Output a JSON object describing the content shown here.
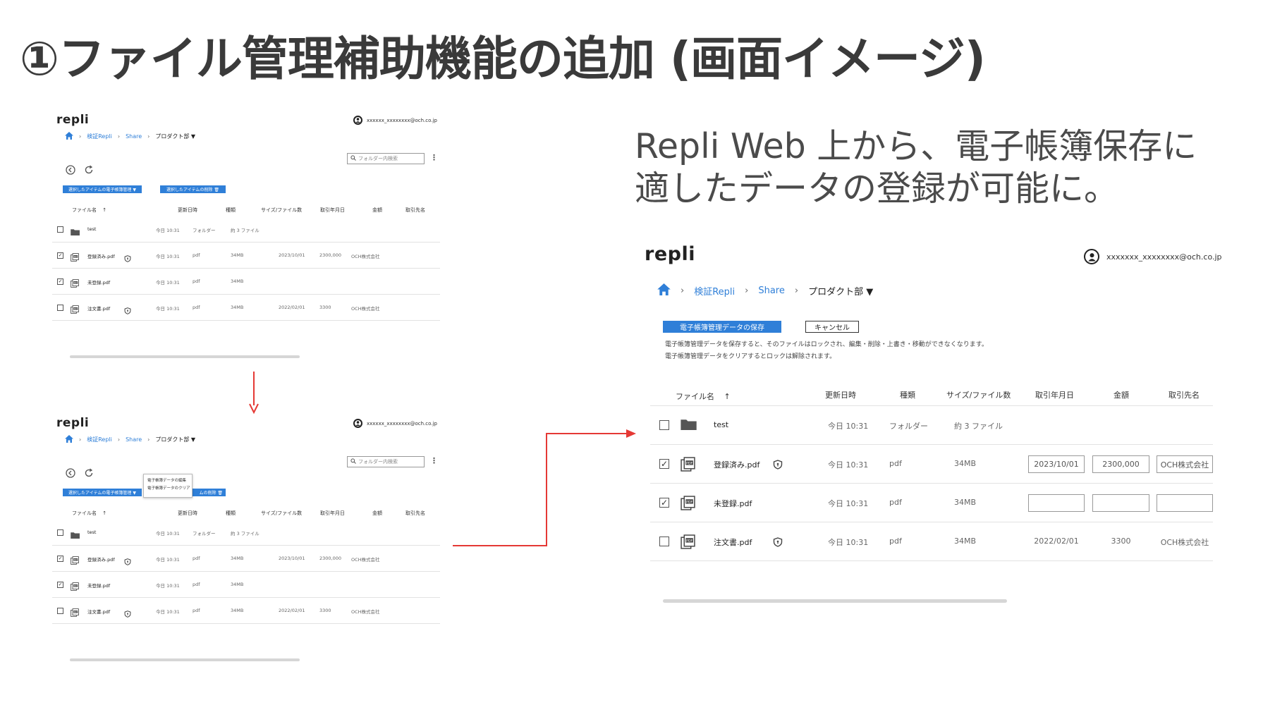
{
  "slide": {
    "title": "①ファイル管理補助機能の追加 (画面イメージ)",
    "description_line1": "Repli Web 上から、電子帳簿保存に",
    "description_line2": "適したデータの登録が可能に。"
  },
  "app": {
    "logo": "repli",
    "account_email": "xxxxxxx_xxxxxxxx@och.co.jp",
    "account_email_small": "xxxxxx_xxxxxxxx@och.co.jp",
    "breadcrumb": [
      "検証Repli",
      "Share",
      "プロダクト部 ▼"
    ],
    "search_placeholder": "フォルダー内検索",
    "btn_edoc_manage": "選択したアイテムの電子帳簿管理 ▼",
    "btn_delete": "選択したアイテムの削除 🗑",
    "btn_delete_partial": "ムの削除 🗑",
    "popup_items": [
      "電子帳簿データの編集",
      "電子帳簿データのクリア"
    ],
    "btn_save_edoc": "電子帳簿管理データの保存",
    "btn_cancel": "キャンセル",
    "note_line1": "電子帳簿管理データを保存すると、そのファイルはロックされ、編集・削除・上書き・移動ができなくなります。",
    "note_line2": "電子帳簿管理データをクリアするとロックは解除されます。",
    "columns": {
      "name": "ファイル名",
      "sort": "↑",
      "updated": "更新日時",
      "type": "種類",
      "size": "サイズ/ファイル数",
      "date": "取引年月日",
      "amount": "金額",
      "partner": "取引先名"
    },
    "rows": [
      {
        "name": "test",
        "updated": "今日 10:31",
        "type": "フォルダー",
        "size": "約 3 ファイル",
        "date": "",
        "amount": "",
        "partner": "",
        "checked": false,
        "kind": "folder",
        "locked": false
      },
      {
        "name": "登録済み.pdf",
        "updated": "今日 10:31",
        "type": "pdf",
        "size": "34MB",
        "date": "2023/10/01",
        "amount": "2300,000",
        "partner": "OCH株式会社",
        "checked": true,
        "kind": "pdf",
        "locked": true
      },
      {
        "name": "未登録.pdf",
        "updated": "今日 10:31",
        "type": "pdf",
        "size": "34MB",
        "date": "",
        "amount": "",
        "partner": "",
        "checked": true,
        "kind": "pdf",
        "locked": false
      },
      {
        "name": "注文書.pdf",
        "updated": "今日 10:31",
        "type": "pdf",
        "size": "34MB",
        "date": "2022/02/01",
        "amount": "3300",
        "partner": "OCH株式会社",
        "checked": false,
        "kind": "pdf",
        "locked": true
      }
    ]
  },
  "colors": {
    "accent": "#2f7fd8",
    "arrow": "#e53935"
  }
}
